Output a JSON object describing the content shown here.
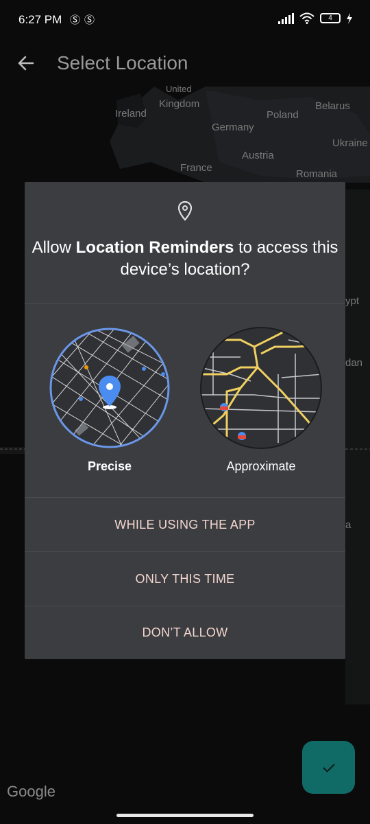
{
  "status": {
    "time": "6:27 PM",
    "notif_icons": [
      "Ⓢ",
      "Ⓢ"
    ],
    "battery": "4"
  },
  "appbar": {
    "title": "Select Location"
  },
  "map": {
    "labels": [
      "United",
      "Kingdom",
      "Ireland",
      "Poland",
      "Belarus",
      "Germany",
      "Ukraine",
      "Austria",
      "France",
      "Romania",
      "ypt",
      "dan",
      "a"
    ],
    "google": "Google"
  },
  "dialog": {
    "prefix": "Allow ",
    "app_name": "Location Reminders",
    "suffix": " to access this device’s location?",
    "precise_label": "Precise",
    "approx_label": "Approximate",
    "while_using": "WHILE USING THE APP",
    "only_this_time": "ONLY THIS TIME",
    "dont_allow": "DON’T ALLOW"
  },
  "colors": {
    "accent": "#f4d6d0",
    "dialog_bg": "#3b3d40",
    "fab": "#106b66",
    "precise_ring": "#6b97e8",
    "roads": "#f0d060"
  }
}
